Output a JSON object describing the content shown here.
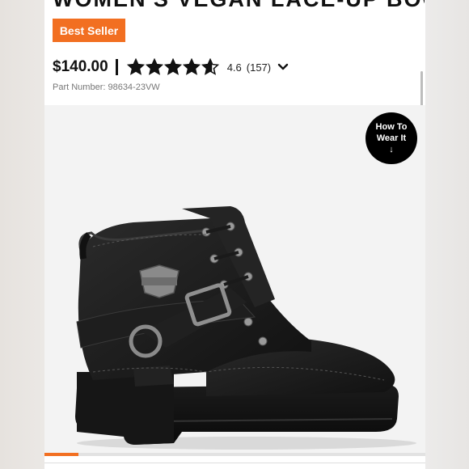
{
  "product": {
    "title": "WOMEN'S VEGAN LACE-UP BOOT",
    "badge": "Best Seller",
    "price": "$140.00",
    "rating": "4.6",
    "rating_value": 4.6,
    "review_count": "(157)",
    "part_number": "Part Number: 98634-23VW"
  },
  "how_to": {
    "line1": "How To",
    "line2": "Wear It",
    "arrow": "↓"
  },
  "carousel": {
    "progress": 0.09
  },
  "colors": {
    "accent": "#f26f21",
    "text": "#111111",
    "muted": "#777777"
  },
  "icons": {
    "star": "star-icon",
    "chevron": "chevron-down-icon",
    "arrow": "arrow-down-icon"
  }
}
